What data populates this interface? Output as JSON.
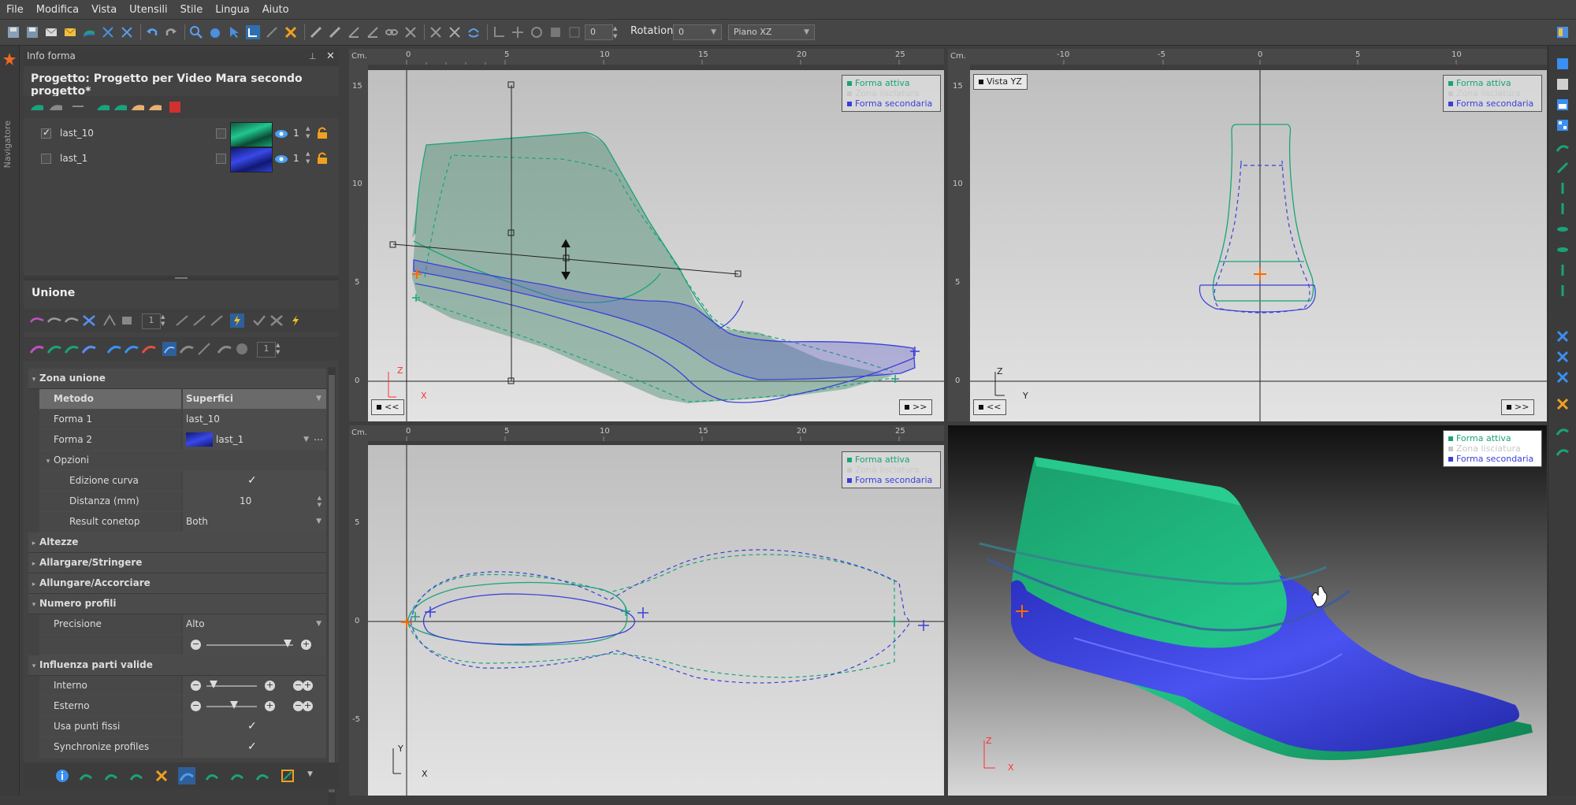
{
  "menu": [
    "File",
    "Modifica",
    "Vista",
    "Utensili",
    "Stile",
    "Lingua",
    "Aiuto"
  ],
  "toolbar": {
    "number_value": "0",
    "rotation_label": "Rotation:",
    "rotation_value": "0",
    "plane_value": "Piano XZ"
  },
  "navigator_label": "Navigatore",
  "info_panel": {
    "title": "Info forma",
    "project_title": "Progetto: Progetto per Video Mara secondo progetto*",
    "lasts": [
      {
        "name": "last_10",
        "checked": true,
        "count": "1"
      },
      {
        "name": "last_1",
        "checked": false,
        "count": "1"
      }
    ]
  },
  "unione": {
    "title": "Unione",
    "step_value": "1",
    "step_value_2": "1",
    "sections": {
      "zona_unione": "Zona unione",
      "altezze": "Altezze",
      "allargare": "Allargare/Stringere",
      "allungare": "Allungare/Accorciare",
      "numero_profili": "Numero profili",
      "influenza": "Influenza parti valide"
    },
    "metodo_label": "Metodo",
    "metodo_value": "Superfici",
    "forma1_label": "Forma 1",
    "forma1_value": "last_10",
    "forma2_label": "Forma 2",
    "forma2_value": "last_1",
    "opzioni_label": "Opzioni",
    "edizione_label": "Edizione curva",
    "distanza_label": "Distanza (mm)",
    "distanza_value": "10",
    "result_label": "Result conetop",
    "result_value": "Both",
    "precisione_label": "Precisione",
    "precisione_value": "Alto",
    "interno_label": "Interno",
    "esterno_label": "Esterno",
    "usa_punti_label": "Usa punti fissi",
    "sync_label": "Synchronize profiles"
  },
  "legend": {
    "attiva": "Forma attiva",
    "lisciatura": "Zona lisciatura",
    "secondaria": "Forma secondaria"
  },
  "colors": {
    "attiva": "#1aa37a",
    "secondaria": "#3a3fd8",
    "marker": "#ff6a00"
  },
  "viewports": {
    "xz": {
      "unit": "Cm.",
      "x_ticks": [
        "0",
        "5",
        "10",
        "15",
        "20",
        "25"
      ],
      "y_ticks": [
        "15",
        "10",
        "5",
        "0"
      ],
      "axis_a": "Z",
      "axis_b": "X",
      "prev": "<<",
      "next": ">>"
    },
    "yz": {
      "unit": "Cm.",
      "title": "Vista YZ",
      "x_ticks": [
        "-10",
        "-5",
        "0",
        "5",
        "10"
      ],
      "y_ticks": [
        "15",
        "10",
        "5",
        "0"
      ],
      "axis_a": "Z",
      "axis_b": "Y",
      "prev": "<<",
      "next": ">>"
    },
    "xy": {
      "unit": "Cm.",
      "x_ticks": [
        "0",
        "5",
        "10",
        "15",
        "20",
        "25"
      ],
      "y_ticks": [
        "5",
        "0",
        "-5"
      ],
      "axis_a": "Y",
      "axis_b": "X"
    },
    "view3d": {
      "axis_a": "Z",
      "axis_b": "X"
    }
  }
}
